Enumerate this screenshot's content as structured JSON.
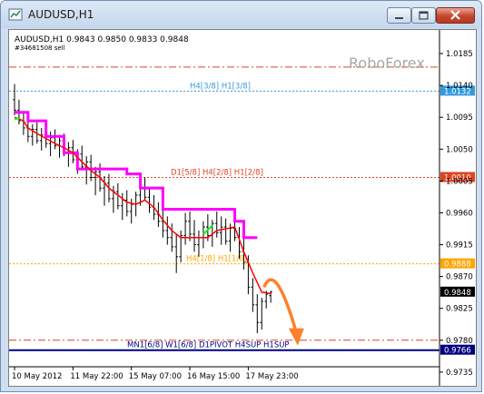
{
  "window": {
    "title": "AUDUSD,H1"
  },
  "chart_header": {
    "symbol_line": "AUDUSD,H1  0.9843  0.9850  0.9833  0.9848",
    "order_line": "#34681508 sell",
    "watermark": "RoboForex"
  },
  "icons": {
    "app": "chart-window-icon",
    "minimize": "minimize-icon",
    "maximize": "maximize-icon",
    "close": "close-icon"
  },
  "colors": {
    "candles": "#000000",
    "murrey_magenta": "#ff00ff",
    "red_line": "#ff0000",
    "green_segment": "#00ff00",
    "forecast_arrow": "#ff7f2a",
    "level_blue": "#3399dd",
    "level_red": "#dd4422",
    "level_orange": "#ffa500",
    "level_navy": "#000080"
  },
  "chart_data": {
    "type": "candlestick",
    "y_ticks": [
      "1.0185",
      "1.0140",
      "1.0095",
      "1.0050",
      "1.0005",
      "0.9960",
      "0.9915",
      "0.9870",
      "0.9825",
      "0.9780",
      "0.9735"
    ],
    "x_ticks": [
      "10 May 2012",
      "11 May 22:00",
      "15 May 07:00",
      "16 May 15:00",
      "17 May 23:00"
    ],
    "ylim": [
      0.9722,
      1.0212
    ],
    "levels": [
      {
        "price": 1.0166,
        "label": "",
        "tag": "",
        "color": "#dd4422",
        "style": "dashdot"
      },
      {
        "price": 1.0132,
        "label": "H4[3/8] H1[3/8]",
        "tag": "1.0132",
        "color": "#3399dd",
        "style": "dotted"
      },
      {
        "price": 1.001,
        "label": "D1[5/8] H4[2/8] H1[2/8]",
        "tag": "1.0010",
        "color": "#dd4422",
        "style": "dotted"
      },
      {
        "price": 0.9888,
        "label": "H4[1/8] H1[1/8]",
        "tag": "0.9888",
        "color": "#ffa500",
        "style": "dotted"
      },
      {
        "price": 0.978,
        "label": "",
        "tag": "",
        "color": "#dd4422",
        "style": "dashdot"
      },
      {
        "price": 0.9766,
        "label": "MN1[6/8] W1[6/8] D1PIVOT H4SUP H1SUP",
        "tag": "0.9766",
        "color": "#000080",
        "style": "solid"
      }
    ],
    "current_price": {
      "value": 0.9848,
      "tag": "0.9848"
    },
    "candles": [
      [
        1.012,
        1.0142,
        1.0098,
        1.0105
      ],
      [
        1.0105,
        1.012,
        1.0085,
        1.009
      ],
      [
        1.009,
        1.0102,
        1.007,
        1.008
      ],
      [
        1.008,
        1.0095,
        1.006,
        1.0068
      ],
      [
        1.0068,
        1.0085,
        1.0055,
        1.0078
      ],
      [
        1.0078,
        1.0088,
        1.0058,
        1.0062
      ],
      [
        1.0062,
        1.008,
        1.0048,
        1.007
      ],
      [
        1.007,
        1.0082,
        1.0052,
        1.0058
      ],
      [
        1.0058,
        1.0075,
        1.004,
        1.0066
      ],
      [
        1.0066,
        1.0078,
        1.005,
        1.0055
      ],
      [
        1.0055,
        1.007,
        1.0038,
        1.0062
      ],
      [
        1.0062,
        1.0072,
        1.004,
        1.0046
      ],
      [
        1.0046,
        1.006,
        1.0025,
        1.0052
      ],
      [
        1.0052,
        1.0063,
        1.003,
        1.0035
      ],
      [
        1.0035,
        1.005,
        1.0015,
        1.0043
      ],
      [
        1.0043,
        1.0055,
        1.002,
        1.0025
      ],
      [
        1.0025,
        1.004,
        1.0,
        1.0032
      ],
      [
        1.0032,
        1.0042,
        1.0005,
        1.001
      ],
      [
        1.001,
        1.0025,
        0.9985,
        1.0018
      ],
      [
        1.0018,
        1.003,
        0.999,
        0.9995
      ],
      [
        0.9995,
        1.0012,
        0.997,
        1.0002
      ],
      [
        1.0002,
        1.0015,
        0.9975,
        0.998
      ],
      [
        0.998,
        0.9998,
        0.996,
        0.999
      ],
      [
        0.999,
        1.0002,
        0.9965,
        0.997
      ],
      [
        0.997,
        0.9988,
        0.995,
        0.9978
      ],
      [
        0.9978,
        0.9992,
        0.9955,
        0.9962
      ],
      [
        0.9962,
        0.998,
        0.9945,
        0.9972
      ],
      [
        0.9972,
        0.999,
        0.9955,
        0.9985
      ],
      [
        0.9985,
        1.0005,
        0.997,
        0.9995
      ],
      [
        0.9995,
        1.001,
        0.9978,
        0.9982
      ],
      [
        0.9982,
        0.9996,
        0.996,
        0.9968
      ],
      [
        0.9968,
        0.9985,
        0.995,
        0.9958
      ],
      [
        0.9958,
        0.9975,
        0.994,
        0.9948
      ],
      [
        0.9948,
        0.9965,
        0.9925,
        0.9935
      ],
      [
        0.9935,
        0.9955,
        0.9915,
        0.9925
      ],
      [
        0.9925,
        0.9945,
        0.9905,
        0.9912
      ],
      [
        0.9912,
        0.993,
        0.9875,
        0.9898
      ],
      [
        0.9898,
        0.9935,
        0.989,
        0.9928
      ],
      [
        0.9928,
        0.996,
        0.9915,
        0.9948
      ],
      [
        0.9948,
        0.9962,
        0.992,
        0.993
      ],
      [
        0.993,
        0.995,
        0.9905,
        0.9915
      ],
      [
        0.9915,
        0.9935,
        0.9898,
        0.9925
      ],
      [
        0.9925,
        0.9948,
        0.991,
        0.994
      ],
      [
        0.994,
        0.9958,
        0.992,
        0.9928
      ],
      [
        0.9928,
        0.995,
        0.9912,
        0.9945
      ],
      [
        0.9945,
        0.9962,
        0.9925,
        0.9932
      ],
      [
        0.9932,
        0.9955,
        0.9915,
        0.994
      ],
      [
        0.994,
        0.9952,
        0.9915,
        0.992
      ],
      [
        0.992,
        0.9945,
        0.9905,
        0.9938
      ],
      [
        0.9938,
        0.9955,
        0.992,
        0.9925
      ],
      [
        0.9925,
        0.994,
        0.9895,
        0.9905
      ],
      [
        0.9905,
        0.9925,
        0.988,
        0.989
      ],
      [
        0.989,
        0.99,
        0.9845,
        0.9855
      ],
      [
        0.9855,
        0.9868,
        0.982,
        0.983
      ],
      [
        0.983,
        0.9845,
        0.979,
        0.9805
      ],
      [
        0.9805,
        0.984,
        0.9795,
        0.9835
      ],
      [
        0.9835,
        0.985,
        0.9825,
        0.9845
      ],
      [
        0.9843,
        0.985,
        0.9833,
        0.9848
      ]
    ],
    "magenta_line": [
      [
        0,
        1.0102
      ],
      [
        3,
        1.0102
      ],
      [
        3,
        1.009
      ],
      [
        7,
        1.009
      ],
      [
        7,
        1.0068
      ],
      [
        11,
        1.0068
      ],
      [
        11,
        1.0045
      ],
      [
        14,
        1.0045
      ],
      [
        14,
        1.0022
      ],
      [
        25,
        1.0022
      ],
      [
        25,
        1.0015
      ],
      [
        28,
        1.0015
      ],
      [
        28,
        0.9995
      ],
      [
        33,
        0.9995
      ],
      [
        33,
        0.9965
      ],
      [
        49,
        0.9965
      ],
      [
        49,
        0.9948
      ],
      [
        51,
        0.9948
      ],
      [
        51,
        0.9925
      ],
      [
        54,
        0.9925
      ]
    ],
    "red_line": [
      [
        0,
        1.0095
      ],
      [
        2,
        1.009
      ],
      [
        3,
        1.008
      ],
      [
        5,
        1.0072
      ],
      [
        7,
        1.0065
      ],
      [
        9,
        1.0058
      ],
      [
        11,
        1.0052
      ],
      [
        13,
        1.0045
      ],
      [
        15,
        1.0032
      ],
      [
        17,
        1.002
      ],
      [
        19,
        1.001
      ],
      [
        21,
        0.9995
      ],
      [
        23,
        0.9985
      ],
      [
        25,
        0.9975
      ],
      [
        27,
        0.9972
      ],
      [
        29,
        0.9978
      ],
      [
        31,
        0.9968
      ],
      [
        33,
        0.995
      ],
      [
        35,
        0.9935
      ],
      [
        37,
        0.9925
      ],
      [
        43,
        0.9925
      ],
      [
        45,
        0.9935
      ],
      [
        49,
        0.994
      ],
      [
        51,
        0.9905
      ],
      [
        53,
        0.9875
      ],
      [
        55,
        0.9848
      ],
      [
        57,
        0.9846
      ]
    ],
    "green_segments": [
      [
        [
          0,
          1.0092
        ],
        [
          1,
          1.0094
        ]
      ],
      [
        [
          42,
          0.993
        ],
        [
          44,
          0.9942
        ]
      ]
    ],
    "forecast_arrow": {
      "from": [
        55.5,
        0.9855
      ],
      "peak": [
        58,
        0.9865
      ],
      "to": [
        63,
        0.977
      ]
    }
  }
}
